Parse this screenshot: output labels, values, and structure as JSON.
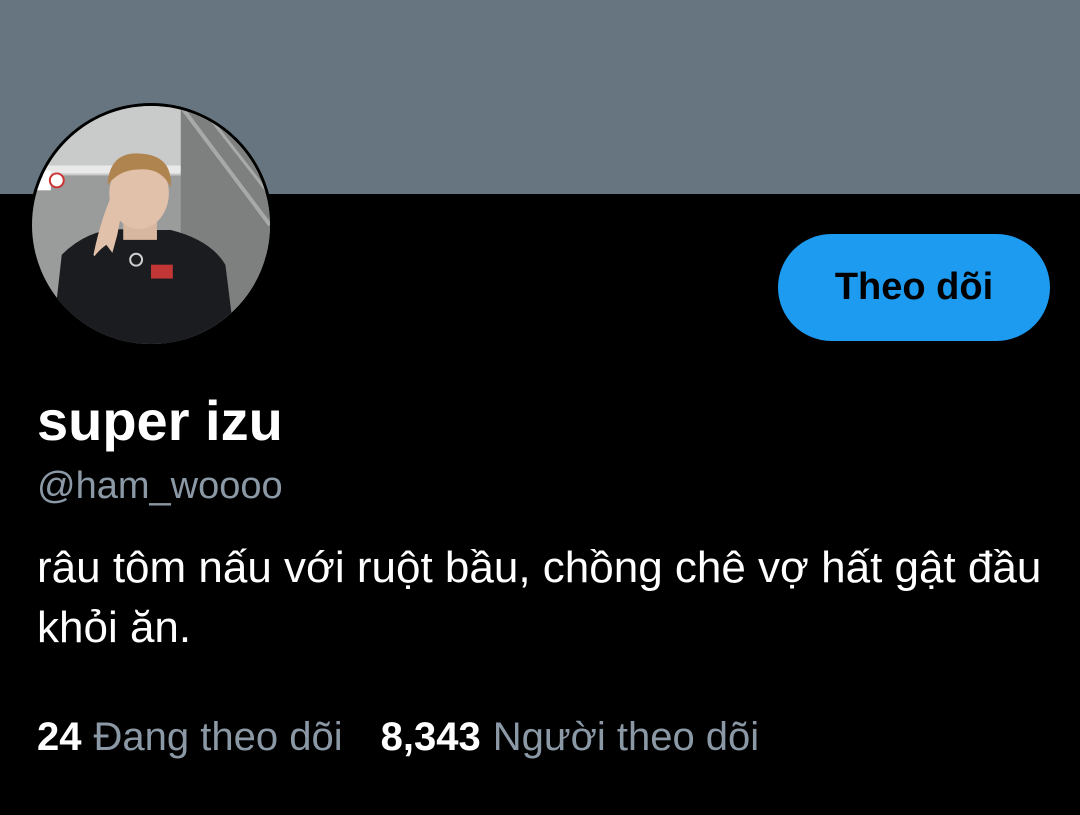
{
  "profile": {
    "display_name": "super izu",
    "handle": "@ham_woooo",
    "bio": "râu tôm nấu với ruột bầu, chồng chê vợ hất gật đầu khỏi ăn.",
    "follow_button_label": "Theo dõi"
  },
  "stats": {
    "following_count": "24",
    "following_label": "Đang theo dõi",
    "followers_count": "8,343",
    "followers_label": "Người theo dõi"
  },
  "colors": {
    "banner": "#66757f",
    "background": "#000000",
    "accent": "#1d9bf0",
    "secondary_text": "#8b98a5"
  }
}
